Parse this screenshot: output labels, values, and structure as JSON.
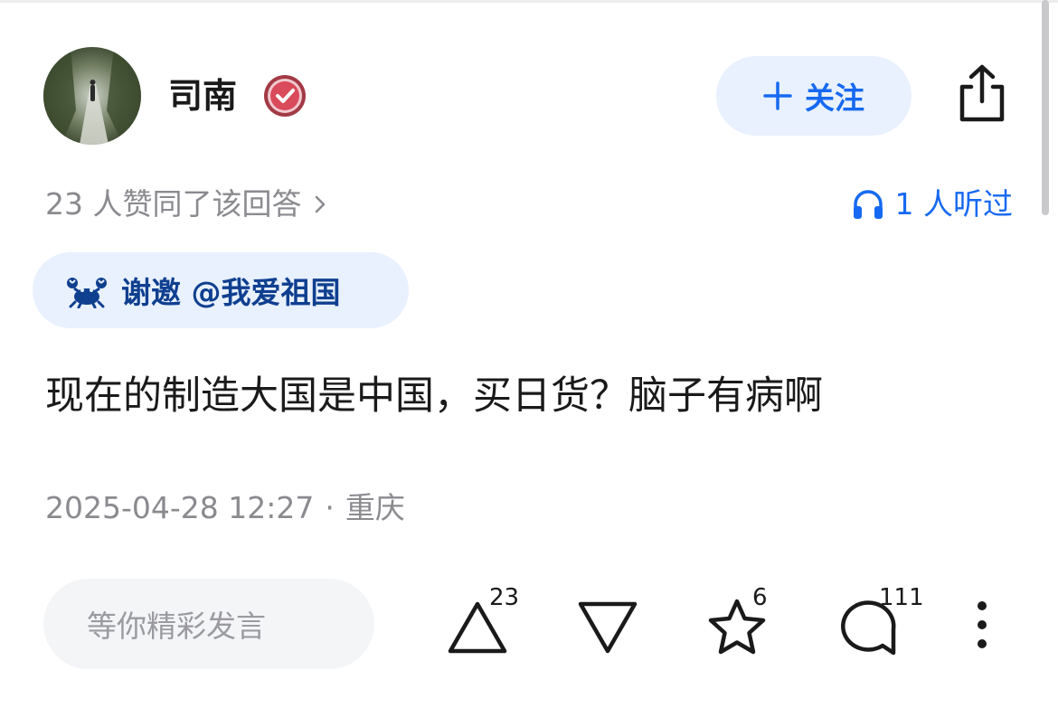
{
  "author": {
    "name": "司南",
    "follow_label": "关注"
  },
  "meta": {
    "agree_text": "23 人赞同了该回答",
    "listen_text": "1 人听过"
  },
  "invite": {
    "text": "谢邀 @我爱祖国"
  },
  "answer": {
    "content": "现在的制造大国是中国，买日货？脑子有病啊",
    "date": "2025-04-28 12:27",
    "separator": "·",
    "location": "重庆"
  },
  "actions": {
    "comment_placeholder": "等你精彩发言",
    "upvote_count": "23",
    "favorite_count": "6",
    "comment_count": "111"
  },
  "colors": {
    "accent": "#1769f1",
    "accent_bg": "#e9f1fe",
    "muted_text": "#8a8a8f",
    "badge_red": "#d94a5b"
  },
  "icons": [
    "avatar",
    "verified-badge-icon",
    "plus-icon",
    "share-icon",
    "chevron-right-icon",
    "headphones-icon",
    "crab-icon",
    "upvote-icon",
    "downvote-icon",
    "star-icon",
    "comment-icon",
    "more-icon"
  ]
}
